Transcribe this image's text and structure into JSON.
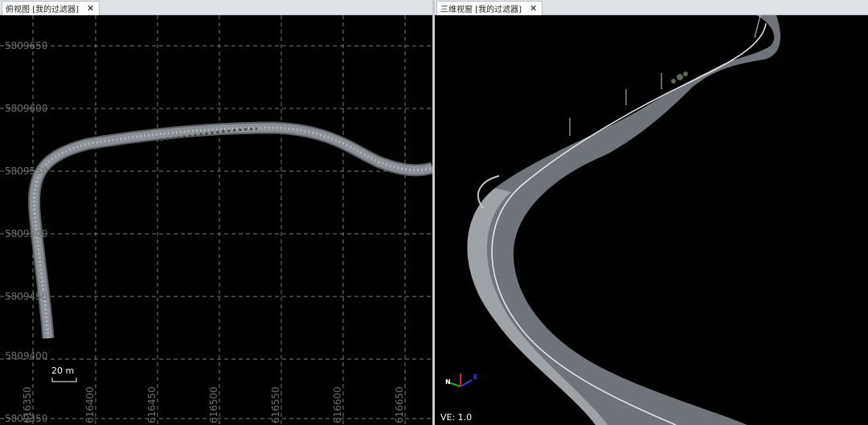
{
  "top_view": {
    "tab_title": "俯视图 [我的过滤器]",
    "close_glyph": "✕",
    "y_labels": [
      "5809650",
      "5809600",
      "5809550",
      "5809500",
      "5809450",
      "5809400",
      "5809350"
    ],
    "x_labels": [
      "616350",
      "616400",
      "616450",
      "616500",
      "616550",
      "616600",
      "616650"
    ],
    "scale_bar": "20 m",
    "road_color": "#8b9096"
  },
  "view_3d": {
    "tab_title": "三维视窗 [我的过滤器]",
    "close_glyph": "✕",
    "ve_label": "VE: 1.0",
    "axis_labels": {
      "north": "N",
      "east": "E"
    },
    "axis_colors": {
      "north": "#1aaa2a",
      "east": "#2f3df0",
      "up": "#e02020"
    }
  }
}
